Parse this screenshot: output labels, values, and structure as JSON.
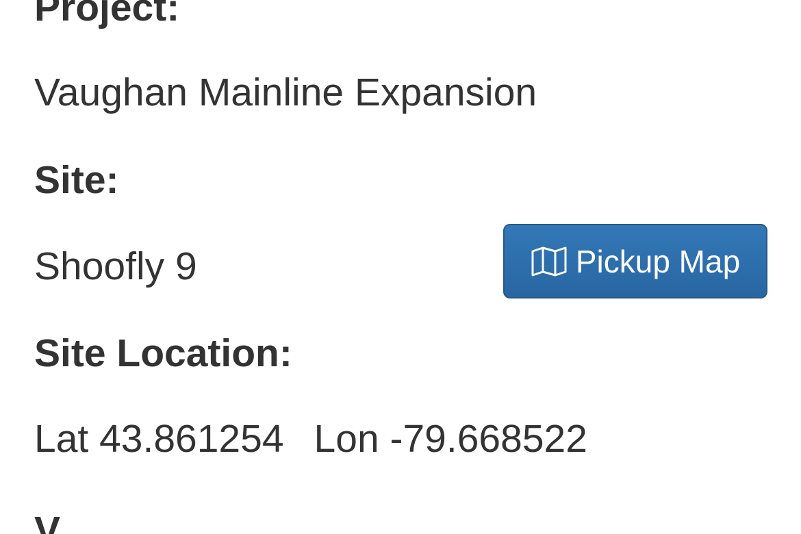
{
  "project": {
    "label": "Project:",
    "value": "Vaughan Mainline Expansion"
  },
  "site": {
    "label": "Site:",
    "value": "Shoofly 9"
  },
  "pickup_map_button": {
    "label": "Pickup Map",
    "icon": "map-icon",
    "color": "#2f6fae"
  },
  "site_location": {
    "label": "Site Location:",
    "lat_label": "Lat",
    "lat_value": "43.861254",
    "lon_label": "Lon",
    "lon_value": "-79.668522"
  },
  "next_section": {
    "label_partial": "V"
  }
}
